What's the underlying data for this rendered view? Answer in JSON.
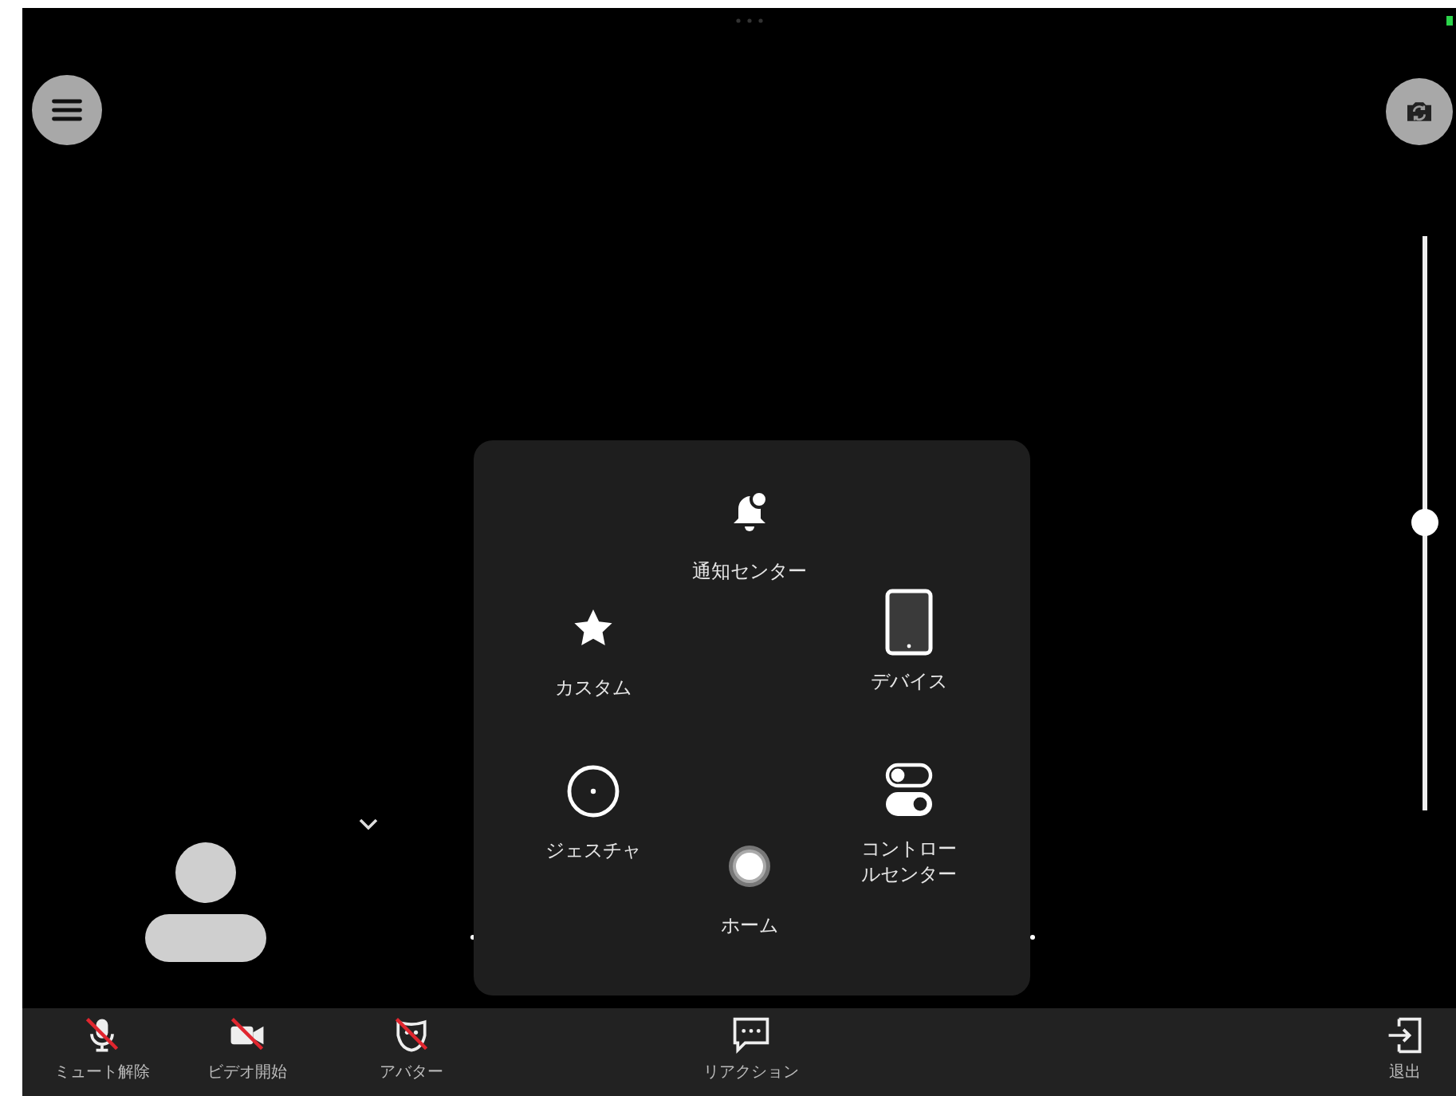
{
  "volume_slider": {
    "level": 0.5
  },
  "assistive_menu": {
    "items": [
      {
        "kind": "notification",
        "label": "通知センター"
      },
      {
        "kind": "custom",
        "label": "カスタム"
      },
      {
        "kind": "device",
        "label": "デバイス"
      },
      {
        "kind": "gesture",
        "label": "ジェスチャ"
      },
      {
        "kind": "home",
        "label": "ホーム"
      },
      {
        "kind": "control",
        "label": "コントロールセンター"
      }
    ]
  },
  "toolbar": {
    "items": [
      {
        "kind": "mic",
        "label": "ミュート解除",
        "off": true
      },
      {
        "kind": "video",
        "label": "ビデオ開始",
        "off": true
      },
      {
        "kind": "avatar",
        "label": "アバター",
        "off": true
      },
      {
        "kind": "reaction",
        "label": "リアクション",
        "off": false
      },
      {
        "kind": "leave",
        "label": "退出",
        "off": false
      }
    ]
  }
}
